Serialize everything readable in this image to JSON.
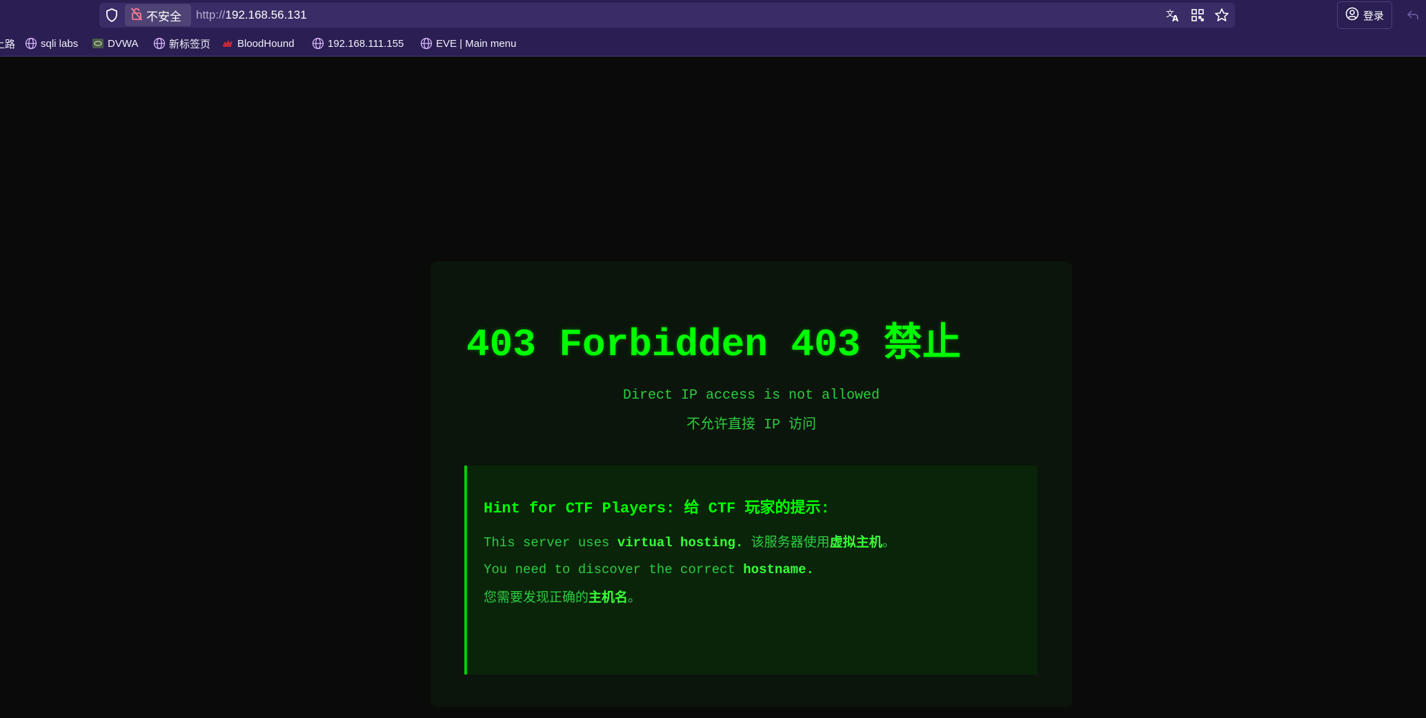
{
  "browser": {
    "insecure_label": "不安全",
    "url_scheme": "http://",
    "url_host": "192.168.56.131",
    "signin_label": "登录",
    "icons": {
      "shield": "shield-icon",
      "lock_off": "insecure-lock-icon",
      "translate": "translate-icon",
      "qr": "qr-code-icon",
      "star": "bookmark-star-icon",
      "account": "account-icon",
      "back": "back-arrow-icon"
    }
  },
  "bookmarks": [
    {
      "label": "上路",
      "icon": "none"
    },
    {
      "label": "sqli labs",
      "icon": "globe-icon"
    },
    {
      "label": "DVWA",
      "icon": "dvwa-icon"
    },
    {
      "label": "新标签页",
      "icon": "globe-icon"
    },
    {
      "label": "BloodHound",
      "icon": "bloodhound-icon"
    },
    {
      "label": "192.168.111.155",
      "icon": "globe-icon"
    },
    {
      "label": "EVE | Main menu",
      "icon": "globe-icon"
    }
  ],
  "page": {
    "title": "403 Forbidden 403 禁止",
    "subtitle_en": "Direct IP access is not allowed",
    "subtitle_cn": "不允许直接 IP 访问",
    "hint": {
      "title": "Hint for CTF Players: 给 CTF 玩家的提示:",
      "line1_pre": "This server uses ",
      "line1_bold": "virtual hosting.",
      "line1_cn_pre": " 该服务器使用",
      "line1_cn_bold": "虚拟主机",
      "line1_cn_post": "。",
      "line2_pre": "You need to discover the correct ",
      "line2_bold": "hostname.",
      "line3_pre": "您需要发现正确的",
      "line3_bold": "主机名",
      "line3_post": "。"
    }
  },
  "colors": {
    "chrome_bg": "#2b1e52",
    "urlbar_bg": "#3a2c66",
    "page_bg": "#0a0a0a",
    "accent_green": "#00ff00",
    "text_green": "#2ecc40"
  }
}
